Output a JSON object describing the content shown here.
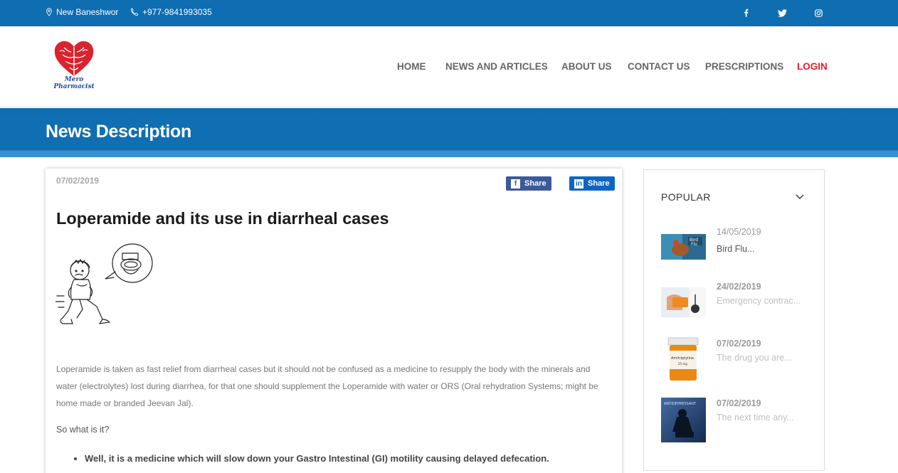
{
  "topbar": {
    "location": "New Baneshwor",
    "phone": "+977-9841993035",
    "social": [
      "facebook-icon",
      "twitter-icon",
      "instagram-icon"
    ]
  },
  "brand": {
    "line1": "Mero",
    "line2": "Pharmacist"
  },
  "nav": {
    "home": "HOME",
    "news": "NEWS AND ARTICLES",
    "about": "ABOUT US",
    "contact": "CONTACT US",
    "prescriptions": "PRESCRIPTIONS",
    "login": "LOGIN"
  },
  "banner": {
    "title": "News Description"
  },
  "article": {
    "date": "07/02/2019",
    "share_facebook": "Share",
    "share_linkedin": "Share",
    "title": "Loperamide and its use in diarrheal cases",
    "paragraph": "Loperamide is taken as fast relief from diarrheal cases but it should not be confused as a medicine to resupply the body with the minerals and water (electrolytes) lost during diarrhea, for that one should supplement the Loperamide with water or ORS (Oral rehydration Systems; might be home made or branded Jeevan Jal).",
    "question": "So what is it?",
    "bullets": [
      "Well, it is a medicine which will slow down your Gastro Intestinal (GI) motility causing delayed defecation."
    ]
  },
  "sidebar": {
    "title": "POPULAR",
    "items": [
      {
        "date": "14/05/2019",
        "title": "Bird Flu..."
      },
      {
        "date": "24/02/2019",
        "title": "Emergency contrac..."
      },
      {
        "date": "07/02/2019",
        "title": "The drug you are..."
      },
      {
        "date": "07/02/2019",
        "title": "The next time any..."
      }
    ]
  },
  "colors": {
    "brand_blue": "#0f6db1",
    "login_red": "#e41d2b",
    "facebook": "#3b5a9a",
    "linkedin": "#0a66c2"
  }
}
